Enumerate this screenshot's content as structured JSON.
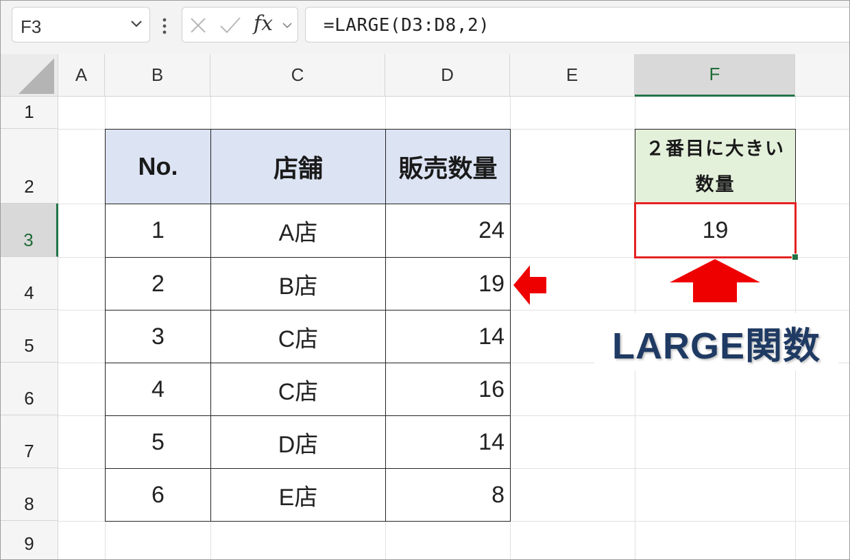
{
  "formula_bar": {
    "name_box": "F3",
    "formula": "=LARGE(D3:D8,2)",
    "fx_label": "fx"
  },
  "columns": [
    "A",
    "B",
    "C",
    "D",
    "E",
    "F"
  ],
  "rows": [
    "1",
    "2",
    "3",
    "4",
    "5",
    "6",
    "7",
    "8",
    "9"
  ],
  "table": {
    "headers": [
      "No.",
      "店舗",
      "販売数量"
    ],
    "rows": [
      [
        "1",
        "A店",
        "24"
      ],
      [
        "2",
        "B店",
        "19"
      ],
      [
        "3",
        "C店",
        "14"
      ],
      [
        "4",
        "C店",
        "16"
      ],
      [
        "5",
        "D店",
        "14"
      ],
      [
        "6",
        "E店",
        "8"
      ]
    ]
  },
  "result": {
    "header_line1": "２番目に大きい",
    "header_line2": "数量",
    "value": "19"
  },
  "caption": "LARGE関数",
  "selected_cell": "F3",
  "colors": {
    "table_header_bg": "#dce3f3",
    "result_header_bg": "#e3f0da",
    "arrow_red": "#ee0000",
    "selection_border": "#e52020",
    "caption_text": "#1f3a63",
    "excel_green": "#217346"
  },
  "icons": [
    "chevron-down-icon",
    "more-options-icon",
    "cancel-icon",
    "enter-icon",
    "function-icon",
    "arrow-left-icon",
    "arrow-up-icon"
  ]
}
